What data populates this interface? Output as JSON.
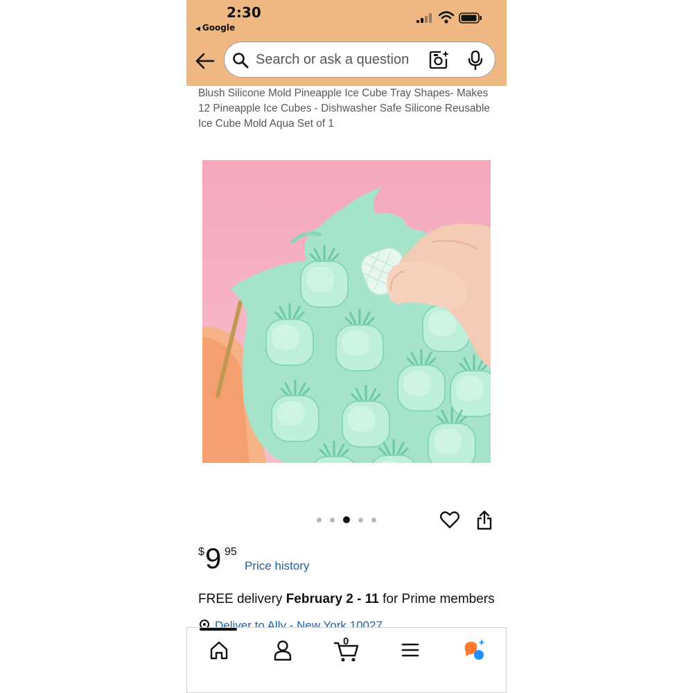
{
  "status_bar": {
    "time": "2:30",
    "back_app": "Google"
  },
  "search": {
    "placeholder": "Search or ask a question"
  },
  "product": {
    "title": "Blush Silicone Mold Pineapple Ice Cube Tray Shapes- Makes 12 Pineapple Ice Cubes - Dishwasher Safe Silicone Reusable Ice Cube Mold Aqua Set of 1",
    "image_count": 5,
    "active_image": 3,
    "price": {
      "currency": "$",
      "whole": "9",
      "fraction": "95"
    },
    "price_history_label": "Price history",
    "delivery": {
      "prefix": "FREE delivery ",
      "dates": "February 2 - 11",
      "suffix": " for Prime members"
    },
    "deliver_to": "Deliver to Ally - New York 10027"
  },
  "bottom_nav": {
    "cart_count": "0",
    "items": [
      "home-icon",
      "account-icon",
      "cart-icon",
      "menu-icon",
      "rufus-icon"
    ]
  },
  "colors": {
    "header": "#efb882",
    "link": "#2162a1",
    "image_background": "#f5b3c3",
    "tray": "#a2e1c8"
  }
}
